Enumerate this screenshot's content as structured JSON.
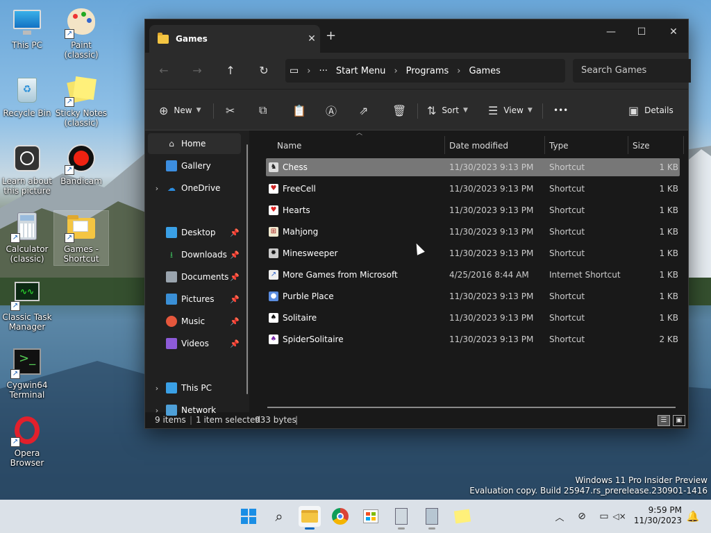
{
  "desktop": {
    "icons": [
      {
        "label": "This PC",
        "icon": "monitor-icon"
      },
      {
        "label": "Paint (classic)",
        "icon": "palette-icon"
      },
      {
        "label": "Recycle Bin",
        "icon": "recycle-bin-icon"
      },
      {
        "label": "Sticky Notes (classic)",
        "icon": "sticky-notes-icon"
      },
      {
        "label": "Learn about this picture",
        "icon": "camera-icon"
      },
      {
        "label": "Bandicam",
        "icon": "record-icon"
      },
      {
        "label": "Calculator (classic)",
        "icon": "calculator-icon"
      },
      {
        "label": "Games - Shortcut",
        "icon": "folder-icon"
      },
      {
        "label": "Classic Task Manager",
        "icon": "task-manager-icon"
      },
      {
        "label": "Cygwin64 Terminal",
        "icon": "terminal-icon"
      },
      {
        "label": "Opera Browser",
        "icon": "opera-icon"
      }
    ]
  },
  "window": {
    "tab_title": "Games",
    "close_tab": "✕",
    "new_tab": "+",
    "controls": {
      "minimize": "—",
      "maximize": "☐",
      "close": "✕"
    },
    "breadcrumb": [
      "Start Menu",
      "Programs",
      "Games"
    ],
    "breadcrumb_more": "···",
    "search_placeholder": "Search Games",
    "toolbar": {
      "new_label": "New",
      "sort_label": "Sort",
      "view_label": "View",
      "more_label": "•••",
      "details_label": "Details"
    },
    "nav": {
      "home": "Home",
      "gallery": "Gallery",
      "onedrive": "OneDrive",
      "pinned": [
        "Desktop",
        "Downloads",
        "Documents",
        "Pictures",
        "Music",
        "Videos"
      ],
      "this_pc": "This PC",
      "network": "Network"
    },
    "columns": [
      "Name",
      "Date modified",
      "Type",
      "Size"
    ],
    "files": [
      {
        "name": "Chess",
        "date": "11/30/2023 9:13 PM",
        "type": "Shortcut",
        "size": "1 KB",
        "selected": true
      },
      {
        "name": "FreeCell",
        "date": "11/30/2023 9:13 PM",
        "type": "Shortcut",
        "size": "1 KB"
      },
      {
        "name": "Hearts",
        "date": "11/30/2023 9:13 PM",
        "type": "Shortcut",
        "size": "1 KB"
      },
      {
        "name": "Mahjong",
        "date": "11/30/2023 9:13 PM",
        "type": "Shortcut",
        "size": "1 KB"
      },
      {
        "name": "Minesweeper",
        "date": "11/30/2023 9:13 PM",
        "type": "Shortcut",
        "size": "1 KB"
      },
      {
        "name": "More Games from Microsoft",
        "date": "4/25/2016 8:44 AM",
        "type": "Internet Shortcut",
        "size": "1 KB"
      },
      {
        "name": "Purble Place",
        "date": "11/30/2023 9:13 PM",
        "type": "Shortcut",
        "size": "1 KB"
      },
      {
        "name": "Solitaire",
        "date": "11/30/2023 9:13 PM",
        "type": "Shortcut",
        "size": "1 KB"
      },
      {
        "name": "SpiderSolitaire",
        "date": "11/30/2023 9:13 PM",
        "type": "Shortcut",
        "size": "2 KB"
      }
    ],
    "status": {
      "count": "9 items",
      "selection": "1 item selected",
      "bytes": "933 bytes"
    }
  },
  "watermark": {
    "line1": "Windows 11 Pro Insider Preview",
    "line2": "Evaluation copy. Build 25947.rs_prerelease.230901-1416"
  },
  "taskbar": {
    "time": "9:59 PM",
    "date": "11/30/2023"
  }
}
